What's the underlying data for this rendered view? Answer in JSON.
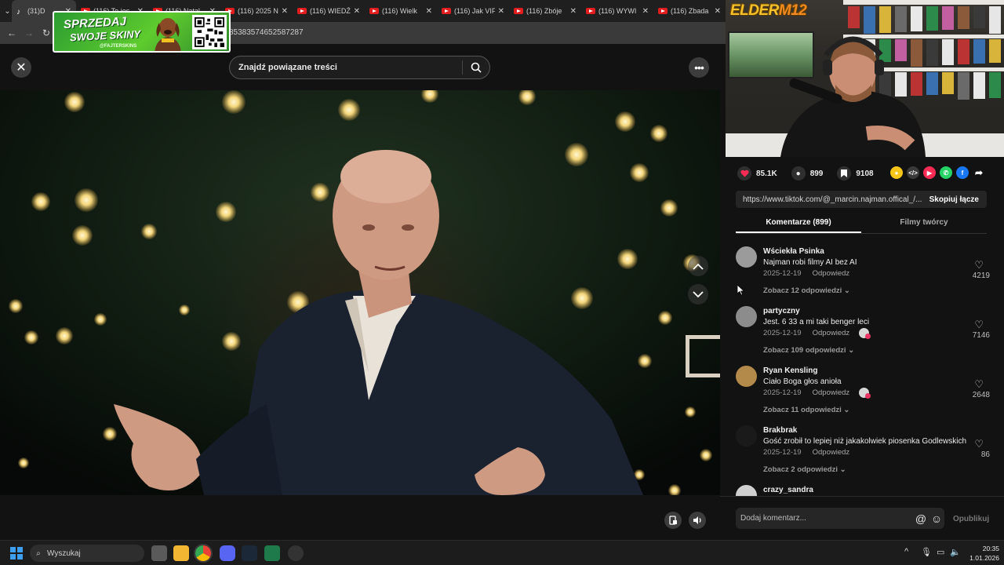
{
  "browser": {
    "tabs": [
      {
        "label": "(31)D",
        "icon": "tiktok-icon",
        "active": true
      },
      {
        "label": "(116) To jes",
        "icon": "youtube-icon"
      },
      {
        "label": "(116) Natal",
        "icon": "youtube-icon"
      },
      {
        "label": "(116) 2025 N",
        "icon": "youtube-icon"
      },
      {
        "label": "(116) WIEDŹ",
        "icon": "youtube-icon"
      },
      {
        "label": "(116) Wielk",
        "icon": "youtube-icon"
      },
      {
        "label": "(116) Jak VIF",
        "icon": "youtube-icon"
      },
      {
        "label": "(116) Zbóje",
        "icon": "youtube-icon"
      },
      {
        "label": "(116) WYWI",
        "icon": "youtube-icon"
      },
      {
        "label": "(116) Zbada",
        "icon": "youtube-icon"
      }
    ],
    "url_fragment": "85383574652587287"
  },
  "ad": {
    "line1": "SPRZEDAJ",
    "line2": "SWOJE SKINY",
    "handle": "@FAJTERSKINS"
  },
  "header": {
    "search_placeholder": "Znajdź powiązane treści"
  },
  "streamer": {
    "logo_part1": "ELDER",
    "logo_part2": "M12"
  },
  "stats": {
    "likes": "85.1K",
    "comments": "899",
    "saves": "9108"
  },
  "share": {
    "link": "https://www.tiktok.com/@_marcin.najman.offical_/...",
    "copy_label": "Skopiuj łącze"
  },
  "tabs": {
    "comments": "Komentarze (899)",
    "creator_videos": "Filmy twórcy"
  },
  "comments": [
    {
      "user": "Wściekła Psinka",
      "text": "Najman robi filmy AI bez AI",
      "date": "2025-12-19",
      "reply": "Odpowiedz",
      "more": "Zobacz 12 odpowiedzi",
      "likes": "4219"
    },
    {
      "user": "partyczny",
      "text": "Jest. 6 33 a mi taki benger leci",
      "date": "2025-12-19",
      "reply": "Odpowiedz",
      "more": "Zobacz 109 odpowiedzi",
      "likes": "7146"
    },
    {
      "user": "Ryan Kensling",
      "text": "Ciało Boga głos anioła",
      "date": "2025-12-19",
      "reply": "Odpowiedz",
      "more": "Zobacz 11 odpowiedzi",
      "likes": "2648"
    },
    {
      "user": "Brakbrak",
      "text": "Gość zrobił to lepiej niż jakakolwiek piosenka Godlewskich",
      "date": "2025-12-19",
      "reply": "Odpowiedz",
      "more": "Zobacz 2 odpowiedzi",
      "likes": "86"
    },
    {
      "user": "crazy_sandra",
      "text": "",
      "date": "",
      "reply": "",
      "more": "",
      "likes": ""
    }
  ],
  "add_comment": {
    "placeholder": "Dodaj komentarz...",
    "publish": "Opublikuj"
  },
  "taskbar": {
    "search": "Wyszukaj",
    "time": "20:35",
    "date": "1.01.2026"
  },
  "colors": {
    "accent_like": "#fe2c55",
    "panel_bg": "#121212",
    "taskbar_blue": "#3c9ff0"
  }
}
